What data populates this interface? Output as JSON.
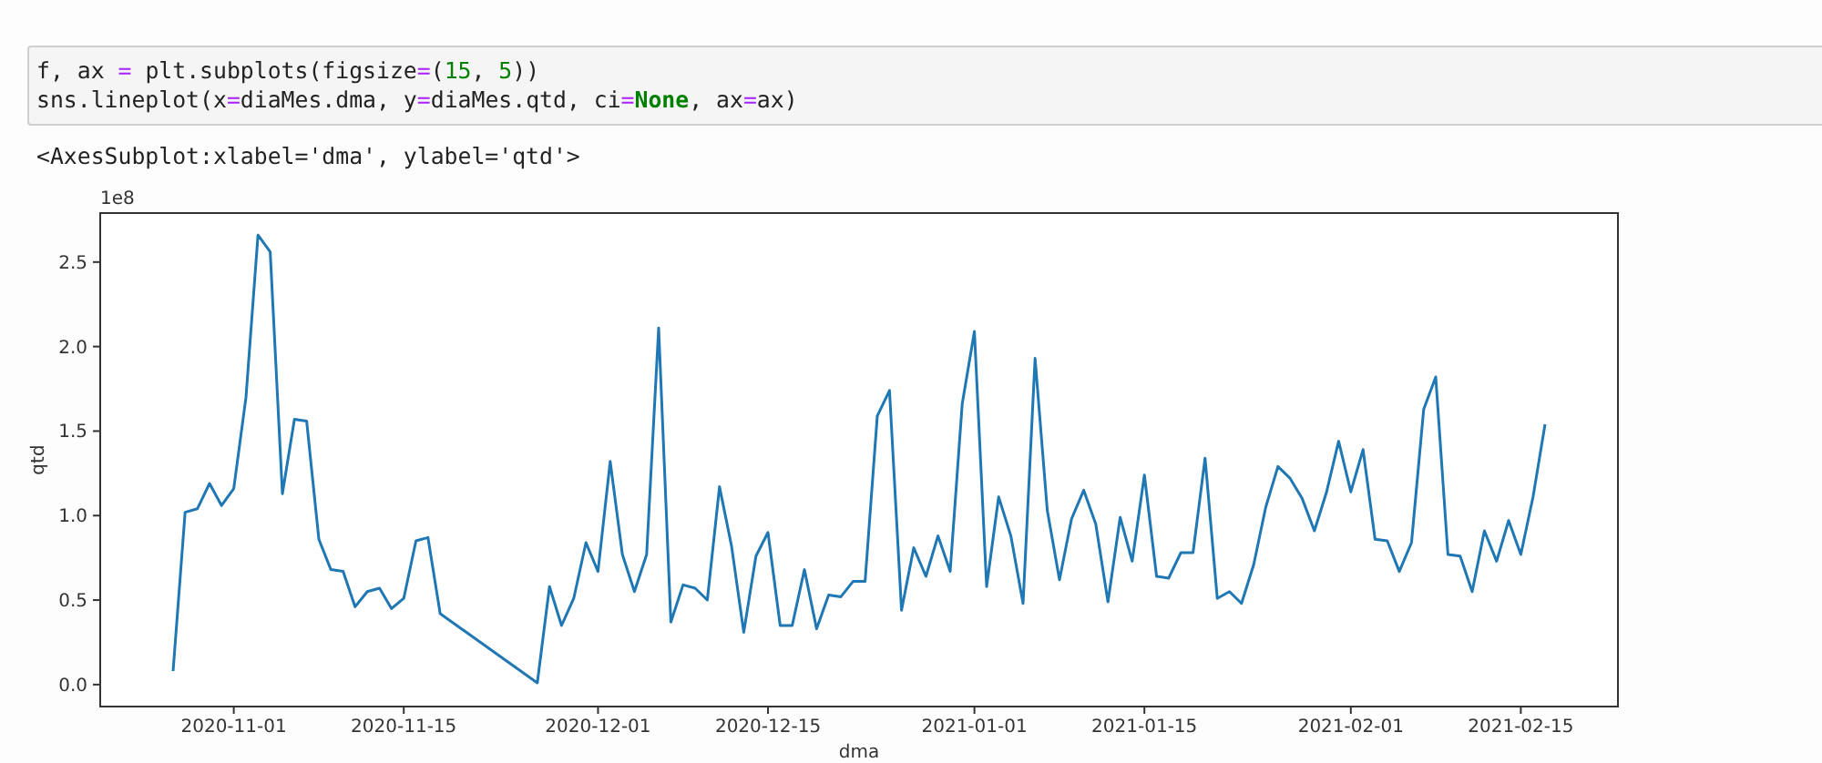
{
  "code_cell": {
    "lines": [
      [
        {
          "text": "f, ax ",
          "kind": "plain"
        },
        {
          "text": "=",
          "kind": "operator"
        },
        {
          "text": " plt.subplots(figsize",
          "kind": "plain"
        },
        {
          "text": "=",
          "kind": "operator"
        },
        {
          "text": "(",
          "kind": "plain"
        },
        {
          "text": "15",
          "kind": "number"
        },
        {
          "text": ", ",
          "kind": "plain"
        },
        {
          "text": "5",
          "kind": "number"
        },
        {
          "text": "))",
          "kind": "plain"
        }
      ],
      [
        {
          "text": "sns.lineplot(x",
          "kind": "plain"
        },
        {
          "text": "=",
          "kind": "operator"
        },
        {
          "text": "diaMes.dma, y",
          "kind": "plain"
        },
        {
          "text": "=",
          "kind": "operator"
        },
        {
          "text": "diaMes.qtd, ci",
          "kind": "plain"
        },
        {
          "text": "=",
          "kind": "operator"
        },
        {
          "text": "None",
          "kind": "keyword"
        },
        {
          "text": ", ax",
          "kind": "plain"
        },
        {
          "text": "=",
          "kind": "operator"
        },
        {
          "text": "ax)",
          "kind": "plain"
        }
      ]
    ]
  },
  "output": {
    "text": "<AxesSubplot:xlabel='dma', ylabel='qtd'>",
    "y_offset_label": "1e8",
    "chart_data": {
      "type": "line",
      "xlabel": "dma",
      "ylabel": "qtd",
      "x": [
        "2020-10-27",
        "2020-10-28",
        "2020-10-29",
        "2020-10-30",
        "2020-10-31",
        "2020-11-01",
        "2020-11-02",
        "2020-11-03",
        "2020-11-04",
        "2020-11-05",
        "2020-11-06",
        "2020-11-07",
        "2020-11-08",
        "2020-11-09",
        "2020-11-10",
        "2020-11-11",
        "2020-11-12",
        "2020-11-13",
        "2020-11-14",
        "2020-11-15",
        "2020-11-16",
        "2020-11-17",
        "2020-11-18",
        "2020-11-26",
        "2020-11-27",
        "2020-11-28",
        "2020-11-29",
        "2020-11-30",
        "2020-12-01",
        "2020-12-02",
        "2020-12-03",
        "2020-12-04",
        "2020-12-05",
        "2020-12-06",
        "2020-12-07",
        "2020-12-08",
        "2020-12-09",
        "2020-12-10",
        "2020-12-11",
        "2020-12-12",
        "2020-12-13",
        "2020-12-14",
        "2020-12-15",
        "2020-12-16",
        "2020-12-17",
        "2020-12-18",
        "2020-12-19",
        "2020-12-20",
        "2020-12-21",
        "2020-12-22",
        "2020-12-23",
        "2020-12-24",
        "2020-12-25",
        "2020-12-26",
        "2020-12-27",
        "2020-12-28",
        "2020-12-29",
        "2020-12-30",
        "2020-12-31",
        "2021-01-01",
        "2021-01-02",
        "2021-01-03",
        "2021-01-04",
        "2021-01-05",
        "2021-01-06",
        "2021-01-07",
        "2021-01-08",
        "2021-01-09",
        "2021-01-10",
        "2021-01-11",
        "2021-01-12",
        "2021-01-13",
        "2021-01-14",
        "2021-01-15",
        "2021-01-16",
        "2021-01-17",
        "2021-01-18",
        "2021-01-19",
        "2021-01-20",
        "2021-01-21",
        "2021-01-22",
        "2021-01-23",
        "2021-01-24",
        "2021-01-25",
        "2021-01-26",
        "2021-01-27",
        "2021-01-28",
        "2021-01-29",
        "2021-01-30",
        "2021-01-31",
        "2021-02-01",
        "2021-02-02",
        "2021-02-03",
        "2021-02-04",
        "2021-02-05",
        "2021-02-06",
        "2021-02-07",
        "2021-02-08",
        "2021-02-09",
        "2021-02-10",
        "2021-02-11",
        "2021-02-12",
        "2021-02-13",
        "2021-02-14",
        "2021-02-15",
        "2021-02-16",
        "2021-02-17"
      ],
      "series": [
        {
          "color": "#1f77b4",
          "values": [
            0.08,
            1.02,
            1.04,
            1.19,
            1.06,
            1.16,
            1.7,
            2.66,
            2.56,
            1.13,
            1.57,
            1.56,
            0.86,
            0.68,
            0.67,
            0.46,
            0.55,
            0.57,
            0.45,
            0.51,
            0.85,
            0.87,
            0.42,
            0.01,
            0.58,
            0.35,
            0.51,
            0.84,
            0.67,
            1.32,
            0.77,
            0.55,
            0.77,
            2.11,
            0.37,
            0.59,
            0.57,
            0.5,
            1.17,
            0.82,
            0.31,
            0.76,
            0.9,
            0.35,
            0.35,
            0.68,
            0.33,
            0.53,
            0.52,
            0.61,
            0.61,
            1.59,
            1.74,
            0.44,
            0.81,
            0.64,
            0.88,
            0.67,
            1.66,
            2.09,
            0.58,
            1.11,
            0.88,
            0.48,
            1.93,
            1.03,
            0.62,
            0.98,
            1.15,
            0.95,
            0.49,
            0.99,
            0.73,
            1.24,
            0.64,
            0.63,
            0.78,
            0.78,
            1.34,
            0.51,
            0.55,
            0.48,
            0.71,
            1.05,
            1.29,
            1.22,
            1.1,
            0.91,
            1.14,
            1.44,
            1.14,
            1.39,
            0.86,
            0.85,
            0.67,
            0.84,
            1.63,
            1.82,
            0.77,
            0.76,
            0.55,
            0.91,
            0.73,
            0.97,
            0.77,
            1.11,
            1.54
          ]
        }
      ],
      "xlim": [
        "2020-10-21",
        "2021-02-23"
      ],
      "ylim": [
        -0.13,
        2.79
      ],
      "xticks": [
        {
          "value": "2020-11-01",
          "label": "2020-11-01"
        },
        {
          "value": "2020-11-15",
          "label": "2020-11-15"
        },
        {
          "value": "2020-12-01",
          "label": "2020-12-01"
        },
        {
          "value": "2020-12-15",
          "label": "2020-12-15"
        },
        {
          "value": "2021-01-01",
          "label": "2021-01-01"
        },
        {
          "value": "2021-01-15",
          "label": "2021-01-15"
        },
        {
          "value": "2021-02-01",
          "label": "2021-02-01"
        },
        {
          "value": "2021-02-15",
          "label": "2021-02-15"
        }
      ],
      "yticks": [
        {
          "value": 0,
          "label": "0.0"
        },
        {
          "value": 0.5,
          "label": "0.5"
        },
        {
          "value": 1,
          "label": "1.0"
        },
        {
          "value": 1.5,
          "label": "1.5"
        },
        {
          "value": 2,
          "label": "2.0"
        },
        {
          "value": 2.5,
          "label": "2.5"
        }
      ]
    }
  }
}
